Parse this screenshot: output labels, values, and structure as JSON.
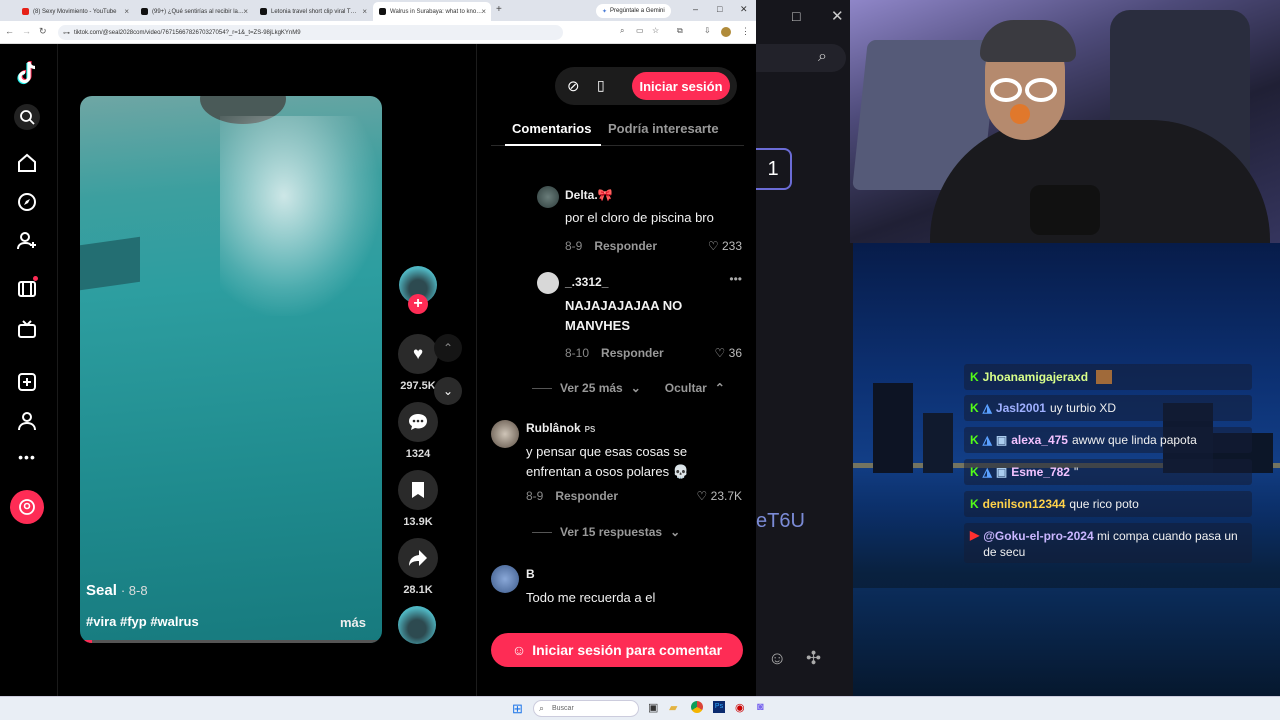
{
  "browser": {
    "tabs": [
      {
        "label": "(8) Sexy Movimiento - YouTube",
        "fav_color": "#e62117"
      },
      {
        "label": "(99+) ¿Qué sentirías al recibir la…",
        "fav_color": "#111111"
      },
      {
        "label": "Letonia travel short clip viral T…",
        "fav_color": "#111111"
      },
      {
        "label": "Walrus in Surabaya: what to kno…",
        "fav_color": "#111111"
      }
    ],
    "gemini_label": "Pregúntale a Gemini",
    "url": "tiktok.com/@seal2028com/video/7671566782670327054?_r=1&_t=ZS-98jLkgKYnM9"
  },
  "tiktok": {
    "login_button": "Iniciar sesión",
    "tabs": [
      "Comentarios",
      "Podría interesarte"
    ],
    "video": {
      "author": "Seal",
      "date": "· 8-8",
      "hashtags": "#vira #fyp #walrus",
      "more": "más"
    },
    "actions": {
      "likes": "297.5K",
      "comments": "1324",
      "saves": "13.9K",
      "shares": "28.1K"
    },
    "comments": [
      {
        "user": "Delta.🎀",
        "text": "por el cloro de piscina bro",
        "date": "8-9",
        "reply": "Responder",
        "likes": "233"
      },
      {
        "user": "_.3312_",
        "text": "NAJAJAJAJAA NO MANVHES",
        "date": "8-10",
        "reply": "Responder",
        "likes": "36"
      },
      {
        "user": "Rublânok",
        "badge": "PS",
        "text": "y pensar que esas cosas se enfrentan a osos polares 💀",
        "date": "8-9",
        "reply": "Responder",
        "likes": "23.7K"
      },
      {
        "user": "B",
        "text": "Todo me recuerda a el"
      }
    ],
    "see_more": "Ver 25 más",
    "hide": "Ocultar",
    "see_replies": "Ver 15 respuestas",
    "comment_login": "Iniciar sesión para comentar",
    "accent": "#fe2c55"
  },
  "stream": {
    "counter": "1",
    "partial_text": "eT6U",
    "chat": [
      {
        "user": "Jhoanamigajeraxd",
        "msg": ""
      },
      {
        "user": "Jasl2001",
        "msg": "uy turbio XD"
      },
      {
        "user": "alexa_475",
        "msg": "awww que linda papota"
      },
      {
        "user": "Esme_782",
        "msg": "\""
      },
      {
        "user": "denilson12344",
        "msg": "que rico poto"
      },
      {
        "user": "@Goku-el-pro-2024",
        "msg": "mi compa cuando pasa un de secu"
      }
    ]
  },
  "taskbar": {
    "search_placeholder": "Buscar"
  }
}
